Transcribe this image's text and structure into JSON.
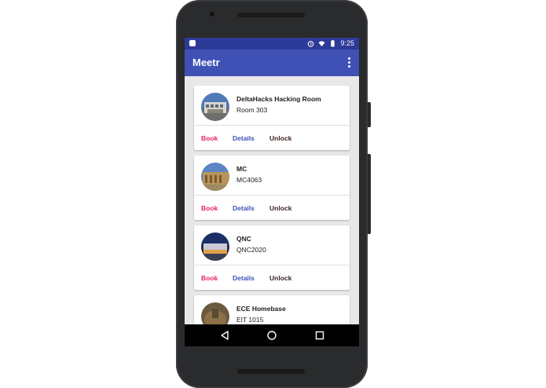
{
  "status_bar": {
    "time": "9:25",
    "icons": [
      "android-notification-icon",
      "alarm-icon",
      "wifi-icon",
      "battery-icon"
    ]
  },
  "app_bar": {
    "title": "Meetr",
    "overflow_icon": "more-vert-icon"
  },
  "rooms": [
    {
      "name": "DeltaHacks Hacking Room",
      "room": "Room 303",
      "avatar": "building-photo-1"
    },
    {
      "name": "MC",
      "room": "MC4063",
      "avatar": "building-photo-2"
    },
    {
      "name": "QNC",
      "room": "QNC2020",
      "avatar": "building-photo-3"
    },
    {
      "name": "ECE Homebase",
      "room": "EIT 1015",
      "avatar": "building-photo-4"
    }
  ],
  "actions": {
    "book": "Book",
    "details": "Details",
    "unlock": "Unlock"
  },
  "colors": {
    "primary": "#3f51b5",
    "primary_dark": "#2c3a98",
    "accent": "#e91e63",
    "unlock": "#3b1f1f",
    "background": "#e8e8e8"
  },
  "nav_bar": {
    "icons": [
      "back-icon",
      "home-icon",
      "recents-icon"
    ]
  }
}
